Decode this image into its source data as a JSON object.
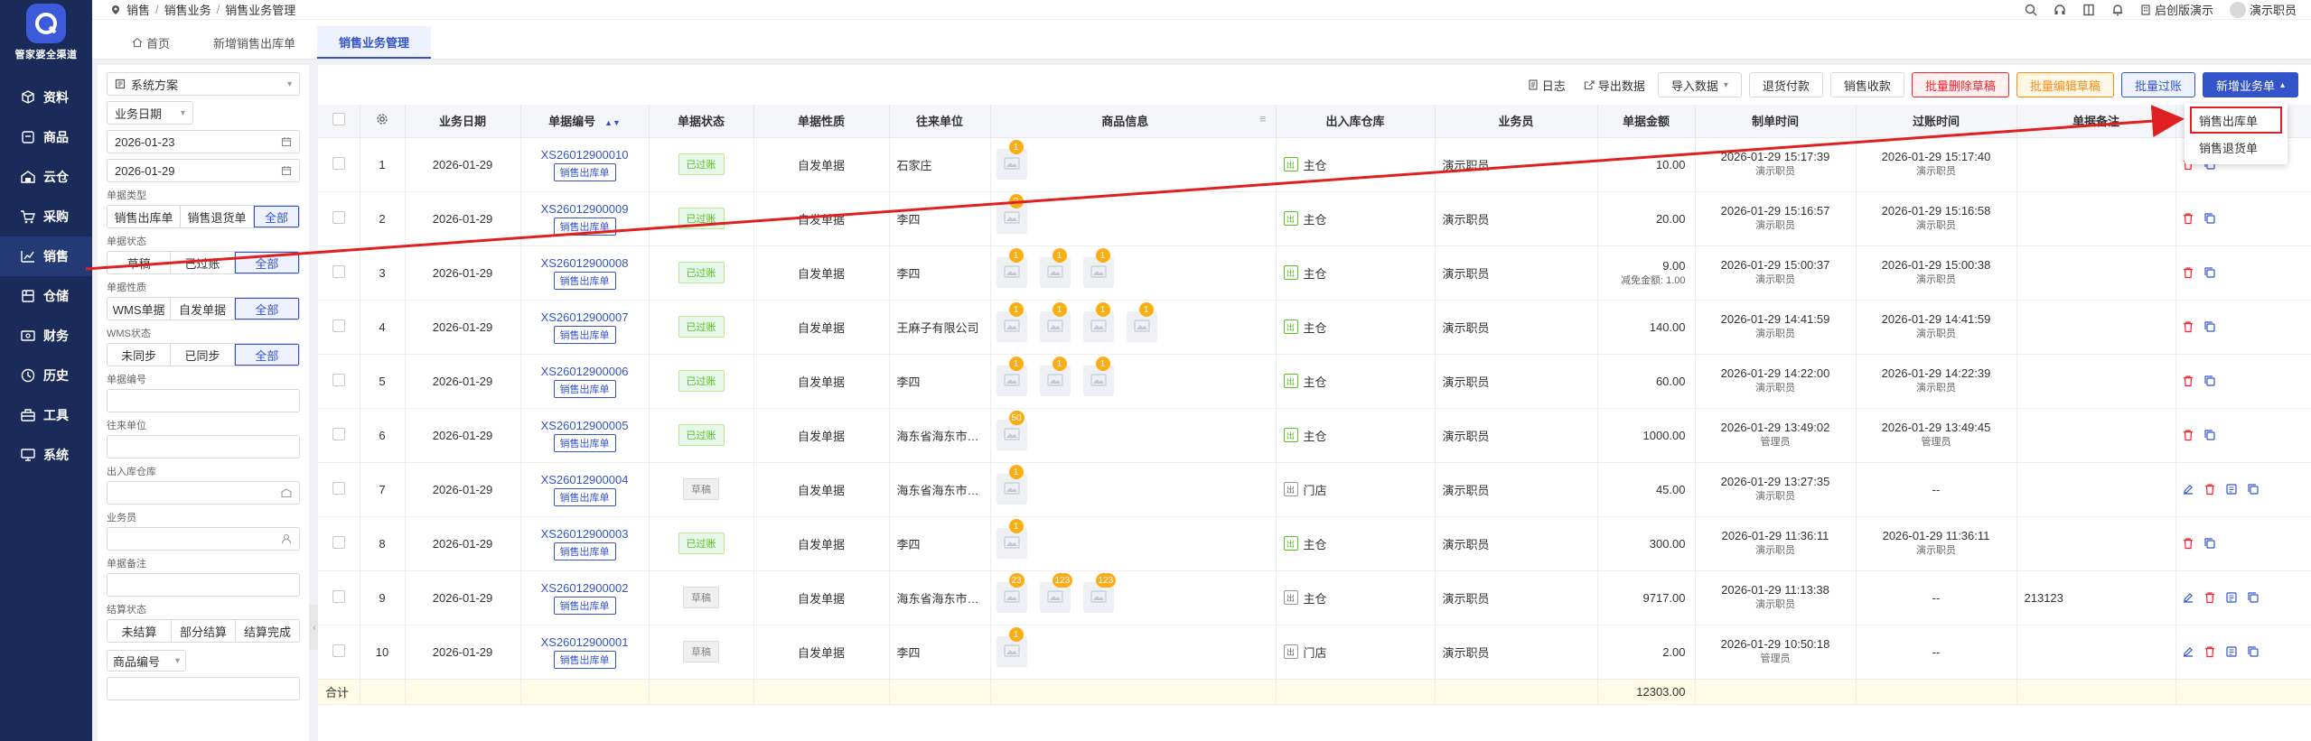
{
  "brand": {
    "logo_text": "管家婆全渠道"
  },
  "nav": [
    {
      "label": "资料",
      "icon": "cube-icon"
    },
    {
      "label": "商品",
      "icon": "box-icon"
    },
    {
      "label": "云仓",
      "icon": "cloud-warehouse-icon"
    },
    {
      "label": "采购",
      "icon": "cart-icon"
    },
    {
      "label": "销售",
      "icon": "sales-chart-icon"
    },
    {
      "label": "仓储",
      "icon": "warehouse-icon"
    },
    {
      "label": "财务",
      "icon": "finance-icon"
    },
    {
      "label": "历史",
      "icon": "history-icon"
    },
    {
      "label": "工具",
      "icon": "toolbox-icon"
    },
    {
      "label": "系统",
      "icon": "monitor-icon"
    }
  ],
  "breadcrumb": [
    "销售",
    "销售业务",
    "销售业务管理"
  ],
  "topright": {
    "account": "启创版演示",
    "user": "演示职员"
  },
  "tabs": [
    "首页",
    "新增销售出库单",
    "销售业务管理"
  ],
  "filters": {
    "scheme": "系统方案",
    "date_type": "业务日期",
    "date_from": "2026-01-23",
    "date_to": "2026-01-29",
    "doc_type_label": "单据类型",
    "doc_type_opts": [
      "销售出库单",
      "销售退货单",
      "全部"
    ],
    "doc_status_label": "单据状态",
    "doc_status_opts": [
      "草稿",
      "已过账",
      "全部"
    ],
    "doc_nature_label": "单据性质",
    "doc_nature_opts": [
      "WMS单据",
      "自发单据",
      "全部"
    ],
    "wms_label": "WMS状态",
    "wms_opts": [
      "未同步",
      "已同步",
      "全部"
    ],
    "doc_no_label": "单据编号",
    "partner_label": "往来单位",
    "warehouse_label": "出入库仓库",
    "salesman_label": "业务员",
    "remark_label": "单据备注",
    "settle_label": "结算状态",
    "settle_opts": [
      "未结算",
      "部分结算",
      "结算完成"
    ],
    "goods_no": "商品编号"
  },
  "toolbar": {
    "log": "日志",
    "export": "导出数据",
    "import": "导入数据",
    "refund": "退货付款",
    "receive": "销售收款",
    "del_draft": "批量删除草稿",
    "edit_draft": "批量编辑草稿",
    "post": "批量过账",
    "new": "新增业务单"
  },
  "dropdown": [
    "销售出库单",
    "销售退货单"
  ],
  "columns": [
    "",
    "",
    "业务日期",
    "单据编号",
    "单据状态",
    "单据性质",
    "往来单位",
    "商品信息",
    "出入库仓库",
    "业务员",
    "单据金额",
    "制单时间",
    "过账时间",
    "单据备注",
    ""
  ],
  "rows": [
    {
      "idx": "1",
      "date": "2026-01-29",
      "no": "XS26012900010",
      "type": "销售出库单",
      "status": "已过账",
      "nature": "自发单据",
      "partner": "石家庄",
      "badges": [
        "1"
      ],
      "wh": "主仓",
      "wh_posted": true,
      "sales": "演示职员",
      "amount": "10.00",
      "discount": "",
      "made": "2026-01-29 15:17:39",
      "maker": "演示职员",
      "posted": "2026-01-29 15:17:40",
      "poster": "演示职员",
      "remark": "",
      "ops": 2
    },
    {
      "idx": "2",
      "date": "2026-01-29",
      "no": "XS26012900009",
      "type": "销售出库单",
      "status": "已过账",
      "nature": "自发单据",
      "partner": "李四",
      "badges": [
        "2"
      ],
      "wh": "主仓",
      "wh_posted": true,
      "sales": "演示职员",
      "amount": "20.00",
      "discount": "",
      "made": "2026-01-29 15:16:57",
      "maker": "演示职员",
      "posted": "2026-01-29 15:16:58",
      "poster": "演示职员",
      "remark": "",
      "ops": 2
    },
    {
      "idx": "3",
      "date": "2026-01-29",
      "no": "XS26012900008",
      "type": "销售出库单",
      "status": "已过账",
      "nature": "自发单据",
      "partner": "李四",
      "badges": [
        "1",
        "1",
        "1"
      ],
      "wh": "主仓",
      "wh_posted": true,
      "sales": "演示职员",
      "amount": "9.00",
      "discount": "减免金额: 1.00",
      "made": "2026-01-29 15:00:37",
      "maker": "演示职员",
      "posted": "2026-01-29 15:00:38",
      "poster": "演示职员",
      "remark": "",
      "ops": 2
    },
    {
      "idx": "4",
      "date": "2026-01-29",
      "no": "XS26012900007",
      "type": "销售出库单",
      "status": "已过账",
      "nature": "自发单据",
      "partner": "王麻子有限公司",
      "badges": [
        "1",
        "1",
        "1",
        "1"
      ],
      "wh": "主仓",
      "wh_posted": true,
      "sales": "演示职员",
      "amount": "140.00",
      "discount": "",
      "made": "2026-01-29 14:41:59",
      "maker": "演示职员",
      "posted": "2026-01-29 14:41:59",
      "poster": "演示职员",
      "remark": "",
      "ops": 2
    },
    {
      "idx": "5",
      "date": "2026-01-29",
      "no": "XS26012900006",
      "type": "销售出库单",
      "status": "已过账",
      "nature": "自发单据",
      "partner": "李四",
      "badges": [
        "1",
        "1",
        "1"
      ],
      "wh": "主仓",
      "wh_posted": true,
      "sales": "演示职员",
      "amount": "60.00",
      "discount": "",
      "made": "2026-01-29 14:22:00",
      "maker": "演示职员",
      "posted": "2026-01-29 14:22:39",
      "poster": "演示职员",
      "remark": "",
      "ops": 2
    },
    {
      "idx": "6",
      "date": "2026-01-29",
      "no": "XS26012900005",
      "type": "销售出库单",
      "status": "已过账",
      "nature": "自发单据",
      "partner": "海东省海东市…",
      "badges": [
        "50"
      ],
      "wh": "主仓",
      "wh_posted": true,
      "sales": "演示职员",
      "amount": "1000.00",
      "discount": "",
      "made": "2026-01-29 13:49:02",
      "maker": "管理员",
      "posted": "2026-01-29 13:49:45",
      "poster": "管理员",
      "remark": "",
      "ops": 2
    },
    {
      "idx": "7",
      "date": "2026-01-29",
      "no": "XS26012900004",
      "type": "销售出库单",
      "status": "草稿",
      "nature": "自发单据",
      "partner": "海东省海东市…",
      "badges": [
        "1"
      ],
      "wh": "门店",
      "wh_posted": false,
      "sales": "演示职员",
      "amount": "45.00",
      "discount": "",
      "made": "2026-01-29 13:27:35",
      "maker": "演示职员",
      "posted": "--",
      "poster": "",
      "remark": "",
      "ops": 4
    },
    {
      "idx": "8",
      "date": "2026-01-29",
      "no": "XS26012900003",
      "type": "销售出库单",
      "status": "已过账",
      "nature": "自发单据",
      "partner": "李四",
      "badges": [
        "1"
      ],
      "wh": "主仓",
      "wh_posted": true,
      "sales": "演示职员",
      "amount": "300.00",
      "discount": "",
      "made": "2026-01-29 11:36:11",
      "maker": "演示职员",
      "posted": "2026-01-29 11:36:11",
      "poster": "演示职员",
      "remark": "",
      "ops": 2
    },
    {
      "idx": "9",
      "date": "2026-01-29",
      "no": "XS26012900002",
      "type": "销售出库单",
      "status": "草稿",
      "nature": "自发单据",
      "partner": "海东省海东市…",
      "badges": [
        "23",
        "123",
        "123"
      ],
      "wh": "主仓",
      "wh_posted": false,
      "sales": "演示职员",
      "amount": "9717.00",
      "discount": "",
      "made": "2026-01-29 11:13:38",
      "maker": "演示职员",
      "posted": "--",
      "poster": "",
      "remark": "213123",
      "ops": 4
    },
    {
      "idx": "10",
      "date": "2026-01-29",
      "no": "XS26012900001",
      "type": "销售出库单",
      "status": "草稿",
      "nature": "自发单据",
      "partner": "李四",
      "badges": [
        "1"
      ],
      "wh": "门店",
      "wh_posted": false,
      "sales": "演示职员",
      "amount": "2.00",
      "discount": "",
      "made": "2026-01-29 10:50:18",
      "maker": "管理员",
      "posted": "--",
      "poster": "",
      "remark": "",
      "ops": 4
    }
  ],
  "summary": {
    "label": "合计",
    "total": "12303.00"
  },
  "colors": {
    "primary": "#3354c9",
    "nav_bg": "#1a2b5a",
    "posted": "#52c41a",
    "badge": "#faad14",
    "danger": "#f5222d",
    "annotation": "#e02020"
  }
}
